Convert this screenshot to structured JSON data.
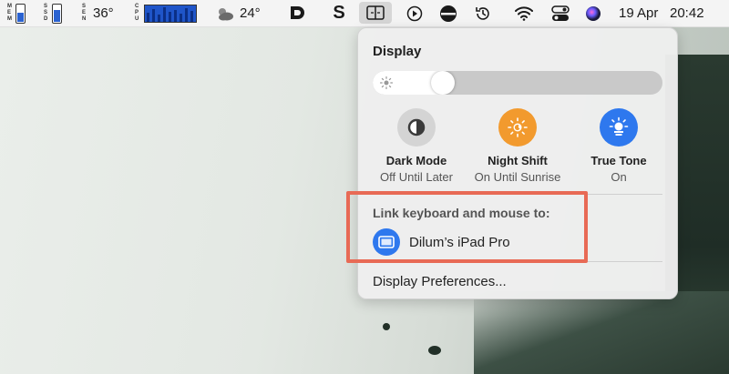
{
  "menubar": {
    "stats": [
      {
        "letters": [
          "M",
          "E",
          "M"
        ],
        "level": 0.55
      },
      {
        "letters": [
          "S",
          "S",
          "D"
        ],
        "level": 0.7
      },
      {
        "letters": [
          "S",
          "E",
          "N"
        ],
        "level": 0
      }
    ],
    "temperature": "36°",
    "cpu_letters": [
      "C",
      "P",
      "U"
    ],
    "weather": "24°",
    "date": "19 Apr",
    "time": "20:42",
    "icons": [
      "d-app-icon",
      "s-app-icon",
      "sidecar-icon",
      "play-icon",
      "vpn-icon",
      "time-machine-icon",
      "wifi-icon",
      "control-center-icon",
      "siri-icon"
    ]
  },
  "display_panel": {
    "title": "Display",
    "brightness": 0.22,
    "modes": [
      {
        "name": "Dark Mode",
        "status": "Off Until Later",
        "icon": "dark-mode-icon",
        "color": "#d4d4d4"
      },
      {
        "name": "Night Shift",
        "status": "On Until Sunrise",
        "icon": "night-shift-icon",
        "color": "#f29a2e"
      },
      {
        "name": "True Tone",
        "status": "On",
        "icon": "true-tone-icon",
        "color": "#2e78ee"
      }
    ],
    "link_title": "Link keyboard and mouse to:",
    "device": "Dilum’s iPad Pro",
    "preferences": "Display Preferences..."
  },
  "colors": {
    "accent": "#2e78ee",
    "highlight_box": "#e86a55"
  }
}
